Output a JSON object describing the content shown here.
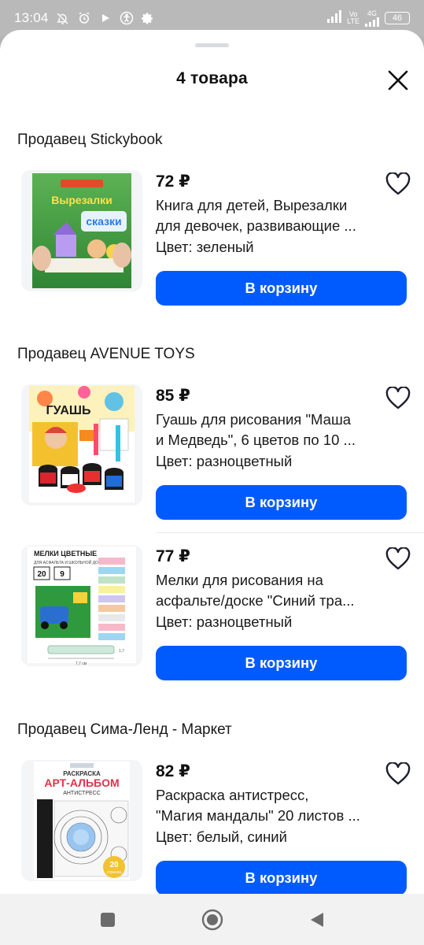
{
  "status_bar": {
    "time": "13:04",
    "icons": [
      "notifications-off-icon",
      "alarm-icon",
      "play-icon",
      "accessibility-icon",
      "settings-icon"
    ],
    "network_label_top": "Vo",
    "network_label_bottom": "LTE",
    "network_type": "4G",
    "battery": "46"
  },
  "sheet": {
    "title": "4 товара",
    "close_icon": "close-icon"
  },
  "sellers": [
    {
      "label": "Продавец Stickybook",
      "products": [
        {
          "price": "72 ₽",
          "name_line1": "Книга для детей, Вырезалки",
          "name_line2": "для девочек, развивающие ...",
          "color": "Цвет: зеленый",
          "button": "В корзину",
          "image_text_top": "Вырезалки",
          "image_text_bottom": "сказки"
        }
      ]
    },
    {
      "label": "Продавец AVENUE TOYS",
      "products": [
        {
          "price": "85 ₽",
          "name_line1": "Гуашь для рисования \"Маша",
          "name_line2": "и Медведь\", 6 цветов по 10 ...",
          "color": "Цвет: разноцветный",
          "button": "В корзину",
          "image_text_top": "ГУАШЬ"
        },
        {
          "price": "77 ₽",
          "name_line1": "Мелки для рисования на",
          "name_line2": "асфальте/доске \"Синий тра...",
          "color": "Цвет: разноцветный",
          "button": "В корзину",
          "image_text_top": "МЕЛКИ ЦВЕТНЫЕ",
          "image_text_sub": "ДЛЯ АСФАЛЬТА И ШКОЛЬНОЙ ДОСКИ",
          "image_count_a": "20",
          "image_count_b": "9",
          "image_dim_w": "7,7 см",
          "image_dim_h": "1,7"
        }
      ]
    },
    {
      "label": "Продавец Сима-Ленд - Маркет",
      "products": [
        {
          "price": "82 ₽",
          "name_line1": "Раскраска антистресс,",
          "name_line2": "\"Магия мандалы\" 20 листов ...",
          "color": "Цвет: белый, синий",
          "button": "В корзину",
          "image_text_top": "РАСКРАСКА",
          "image_text_title": "АРТ-АЛЬБОМ",
          "image_text_sub": "АНТИСТРЕСС",
          "image_badge_num": "20",
          "image_badge_text": "страниц"
        }
      ]
    }
  ],
  "favorite_icon": "heart-outline-icon",
  "nav_bar": [
    "recent-apps-icon",
    "home-icon",
    "back-icon"
  ],
  "colors": {
    "accent": "#005bff",
    "text": "#1a1a1a",
    "status_bar": "#b9b9b9",
    "nav_bar": "#f2f2f2"
  }
}
